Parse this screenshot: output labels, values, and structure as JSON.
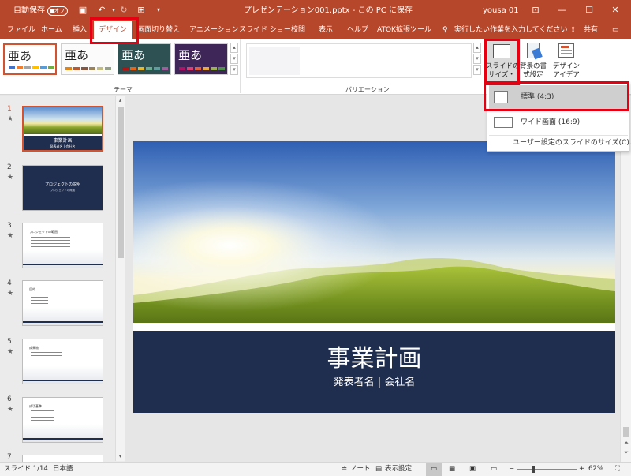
{
  "titlebar": {
    "autosave_label": "自動保存",
    "autosave_state": "オフ",
    "document_title": "プレゼンテーション001.pptx - この PC に保存",
    "user": "yousa 01"
  },
  "tabs": [
    "ファイル",
    "ホーム",
    "挿入",
    "デザイン",
    "画面切り替え",
    "アニメーション",
    "スライド ショー",
    "校閲",
    "表示",
    "ヘルプ",
    "ATOK拡張ツール"
  ],
  "tell_me": "実行したい作業を入力してください",
  "share": "共有",
  "ribbon": {
    "theme_glyph": "亜あ",
    "themes_group": "テーマ",
    "variations_group": "バリエーション",
    "slide_size_label": "スライドの\nサイズ・",
    "bg_format_label": "背景の書\n式設定",
    "design_ideas_label": "デザイン\nアイデア"
  },
  "slide_size_menu": {
    "standard": "標準 (4:3)",
    "wide": "ワイド画面 (16:9)",
    "custom": "ユーザー設定のスライドのサイズ(C)..."
  },
  "thumbnails": [
    {
      "num": "1",
      "star": "★",
      "title": "事業計画",
      "sub": "発表者名 | 会社名"
    },
    {
      "num": "2",
      "star": "★",
      "title": "プロジェクトの説明",
      "sub": "プロジェクトの概要"
    },
    {
      "num": "3",
      "star": "★",
      "title": "プロジェクトの範囲"
    },
    {
      "num": "4",
      "star": "★",
      "title": "目的"
    },
    {
      "num": "5",
      "star": "★",
      "title": "成果物"
    },
    {
      "num": "6",
      "star": "★",
      "title": "成功基準"
    },
    {
      "num": "7"
    }
  ],
  "slide": {
    "title": "事業計画",
    "subtitle": "発表者名 | 会社名"
  },
  "status": {
    "slide_counter": "スライド 1/14",
    "language": "日本語",
    "notes": "ノート",
    "display_settings": "表示設定",
    "zoom": "62%"
  },
  "colors": {
    "accent": "#b7472a",
    "highlight": "#e60012",
    "slide_band": "#1f2d4e"
  }
}
